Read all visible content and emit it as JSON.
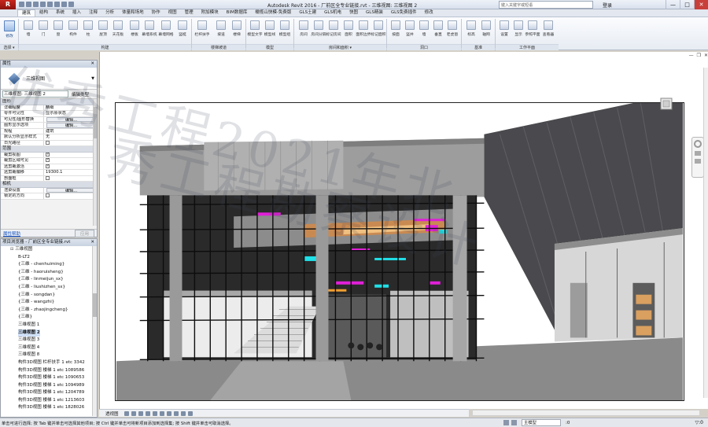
{
  "window": {
    "app_button": "R",
    "title": "Autodesk Revit 2016 - 厂前区全专业链接.rvt - 三维视图: 三维视图 2",
    "search_placeholder": "键入关键字或短语",
    "login": "登录",
    "minimize": "—",
    "maximize": "□",
    "close": "✕"
  },
  "ribbon": {
    "tabs": [
      {
        "label": "建筑",
        "active": true
      },
      {
        "label": "结构"
      },
      {
        "label": "系统"
      },
      {
        "label": "插入"
      },
      {
        "label": "注释"
      },
      {
        "label": "分析"
      },
      {
        "label": "体量和场地"
      },
      {
        "label": "协作"
      },
      {
        "label": "视图"
      },
      {
        "label": "管理"
      },
      {
        "label": "附加模块"
      },
      {
        "label": "BIM数据库"
      },
      {
        "label": "橄榄山快模-免费版"
      },
      {
        "label": "GLS土建"
      },
      {
        "label": "GLS机电"
      },
      {
        "label": "快图"
      },
      {
        "label": "GLS精装"
      },
      {
        "label": "GLS免费插件"
      },
      {
        "label": "修改"
      }
    ],
    "buttons": {
      "modify": "修改",
      "wall": "墙",
      "door": "门",
      "window": "窗",
      "component": "构件",
      "column": "柱",
      "roof": "屋顶",
      "ceiling": "天花板",
      "floor": "楼板",
      "curtain_system": "幕墙系统",
      "curtain_grid": "幕墙网格",
      "mullion": "竖梃",
      "railing": "栏杆扶手",
      "ramp": "坡道",
      "stair": "楼梯",
      "model_text": "模型文字",
      "model_line": "模型线",
      "model_group": "模型组",
      "room": "房间",
      "room_separator": "房间分隔",
      "tag_room": "标记房间",
      "area": "面积",
      "area_boundary": "面积边界",
      "tag_area": "标记面积",
      "by_face": "按面",
      "shaft": "竖井",
      "wall_opening": "墙",
      "vertical": "垂直",
      "dormer": "老虎窗",
      "level": "标高",
      "grid": "轴网",
      "set": "设置",
      "show": "显示",
      "ref_plane": "参照平面",
      "viewer": "查看器"
    },
    "panels": {
      "select": "选择 ▾",
      "build": "构建",
      "circulation": "楼梯坡道",
      "model": "模型",
      "room_area": "房间和面积 ▾",
      "opening": "洞口",
      "datum": "基准",
      "work_plane": "工作平面"
    }
  },
  "properties": {
    "title": "属性",
    "close": "✕",
    "type_name": "三维视图",
    "instance_selector": "三维视图: 三维视图 2",
    "edit_type": "编辑类型",
    "groups": {
      "graphics": "图形",
      "extents": "范围",
      "camera": "相机"
    },
    "rows": {
      "detail_level": {
        "k": "详细程度",
        "v": "精细"
      },
      "parts_visibility": {
        "k": "零件可见性",
        "v": "显示原状态"
      },
      "vg_overrides": {
        "k": "可见性/图形替换",
        "v": "编辑..."
      },
      "graphic_display": {
        "k": "图形显示选项",
        "v": "编辑..."
      },
      "discipline": {
        "k": "规程",
        "v": "建筑"
      },
      "default_analysis": {
        "k": "默认分析显示样式",
        "v": "无"
      },
      "sun_path": {
        "k": "日光路径",
        "v": ""
      },
      "crop_view": {
        "k": "裁剪视图",
        "v": ""
      },
      "crop_visible": {
        "k": "裁剪区域可见",
        "v": ""
      },
      "far_clip_active": {
        "k": "远剪裁激活",
        "v": ""
      },
      "far_clip_offset": {
        "k": "远剪裁偏移",
        "v": "19300.1"
      },
      "section_box": {
        "k": "剖面框",
        "v": ""
      },
      "render_settings": {
        "k": "渲染设置",
        "v": "编辑..."
      },
      "locked_orientation": {
        "k": "锁定的方向",
        "v": ""
      }
    },
    "help_link": "属性帮助",
    "apply": "应用"
  },
  "browser": {
    "title": "项目浏览器 - 厂前区全专业链接.rvt",
    "close": "✕",
    "items": [
      {
        "label": "三维视图",
        "level": 0,
        "toggle": "⊟"
      },
      {
        "label": "B-LT2",
        "level": 1
      },
      {
        "label": "{三维 - chenhuiming}",
        "level": 1
      },
      {
        "label": "{三维 - haoruisheng}",
        "level": 1
      },
      {
        "label": "{三维 - linmeijun_sx}",
        "level": 1
      },
      {
        "label": "{三维 - liushizhen_sx}",
        "level": 1
      },
      {
        "label": "{三维 - songdan}",
        "level": 1
      },
      {
        "label": "{三维 - wangzhi}",
        "level": 1
      },
      {
        "label": "{三维 - zhaojingcheng}",
        "level": 1
      },
      {
        "label": "{三维}",
        "level": 1
      },
      {
        "label": "三维视图 1",
        "level": 1
      },
      {
        "label": "三维视图 2",
        "level": 1,
        "selected": true
      },
      {
        "label": "三维视图 3",
        "level": 1
      },
      {
        "label": "三维视图 4",
        "level": 1
      },
      {
        "label": "三维视图 8",
        "level": 1
      },
      {
        "label": "构件3D视图 栏杆扶手 1 etc 3342",
        "level": 1
      },
      {
        "label": "构件3D视图 楼梯 1 etc 1089586",
        "level": 1
      },
      {
        "label": "构件3D视图 楼梯 1 etc 1090653",
        "level": 1
      },
      {
        "label": "构件3D视图 楼梯 1 etc 1094989",
        "level": 1
      },
      {
        "label": "构件3D视图 楼梯 1 etc 1204789",
        "level": 1
      },
      {
        "label": "构件3D视图 楼梯 1 etc 1213603",
        "level": 1
      },
      {
        "label": "构件3D视图 楼梯 1 etc 1828026",
        "level": 1
      }
    ]
  },
  "viewport": {
    "min": "—",
    "restore": "❐",
    "close": "✕",
    "viewbar_label": "透视图"
  },
  "status": {
    "text": "单击可进行选择; 按 Tab 键并单击可选择其他项目; 按 Ctrl 键并单击可将新项目添加到选择集; 按 Shift 键并单击可取消选择。",
    "model_field": "主模型",
    "zero": ":0",
    "filter": "▽:0"
  },
  "watermark": {
    "line1": "优秀工程2021年北",
    "line2": "秀工程勘察设计"
  },
  "colors": {
    "ribbon_active": "#fbfcfe",
    "selection": "#cfe0f7",
    "accent_magenta": "#e020d8",
    "accent_cyan": "#20e0e8",
    "accent_orange": "#f0a030"
  }
}
